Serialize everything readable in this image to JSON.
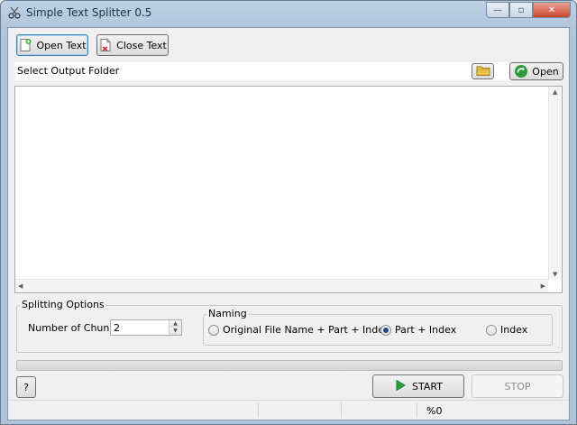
{
  "window": {
    "title": "Simple Text Splitter 0.5",
    "minimize_glyph": "—",
    "maximize_glyph": "▫",
    "close_glyph": "✕"
  },
  "toolbar": {
    "open_text_label": "Open Text",
    "close_text_label": "Close Text"
  },
  "output": {
    "label": "Select Output Folder",
    "open_label": "Open"
  },
  "splitting": {
    "legend": "Splitting Options",
    "chunks_label": "Number of Chunks:",
    "chunks_value": "2"
  },
  "naming": {
    "legend": "Naming",
    "options": [
      {
        "label": "Original File Name + Part + Index",
        "checked": false
      },
      {
        "label": "Part + Index",
        "checked": true
      },
      {
        "label": "Index",
        "checked": false
      }
    ]
  },
  "progress": {
    "value": 0
  },
  "actions": {
    "help_label": "?",
    "start_label": "START",
    "stop_label": "STOP"
  },
  "status": {
    "percent": "%0"
  },
  "colors": {
    "title_bar": "#bcd0e6",
    "progress_fill": "#3cb14a",
    "start_icon": "#2ea043",
    "folder_icon": "#e8c54a"
  },
  "icons": {
    "app": "scissors-icon",
    "open_text": "document-add-icon",
    "close_text": "document-remove-icon",
    "browse": "folder-icon",
    "open": "refresh-arrow-icon",
    "start": "play-icon"
  }
}
